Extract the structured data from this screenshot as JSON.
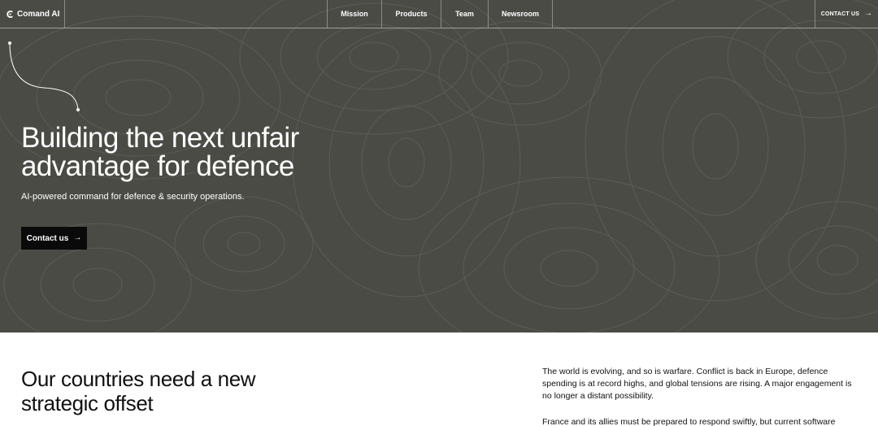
{
  "nav": {
    "brand": "Comand AI",
    "links": [
      {
        "label": "Mission"
      },
      {
        "label": "Products"
      },
      {
        "label": "Team"
      },
      {
        "label": "Newsroom"
      }
    ],
    "contact_label": "CONTACT US"
  },
  "hero": {
    "title": "Building the next unfair advantage for defence",
    "subtitle": "AI-powered command for defence & security operations.",
    "cta_label": "Contact us"
  },
  "section": {
    "title": "Our countries need a new strategic offset",
    "paragraph_1": "The world is evolving, and so is warfare. Conflict is back in Europe, defence spending is at record highs, and global tensions are rising. A major engagement is no longer a distant possibility.",
    "paragraph_2": "France and its allies must be prepared to respond swiftly, but current software"
  },
  "colors": {
    "hero_bg": "#4b4b46",
    "contour": "#5c5c56",
    "button_bg": "#0a0a0a",
    "text_light": "#ffffff",
    "text_dark": "#111111"
  },
  "icons": {
    "brand": "comand-logo-icon",
    "arrow": "arrow-right-icon"
  }
}
